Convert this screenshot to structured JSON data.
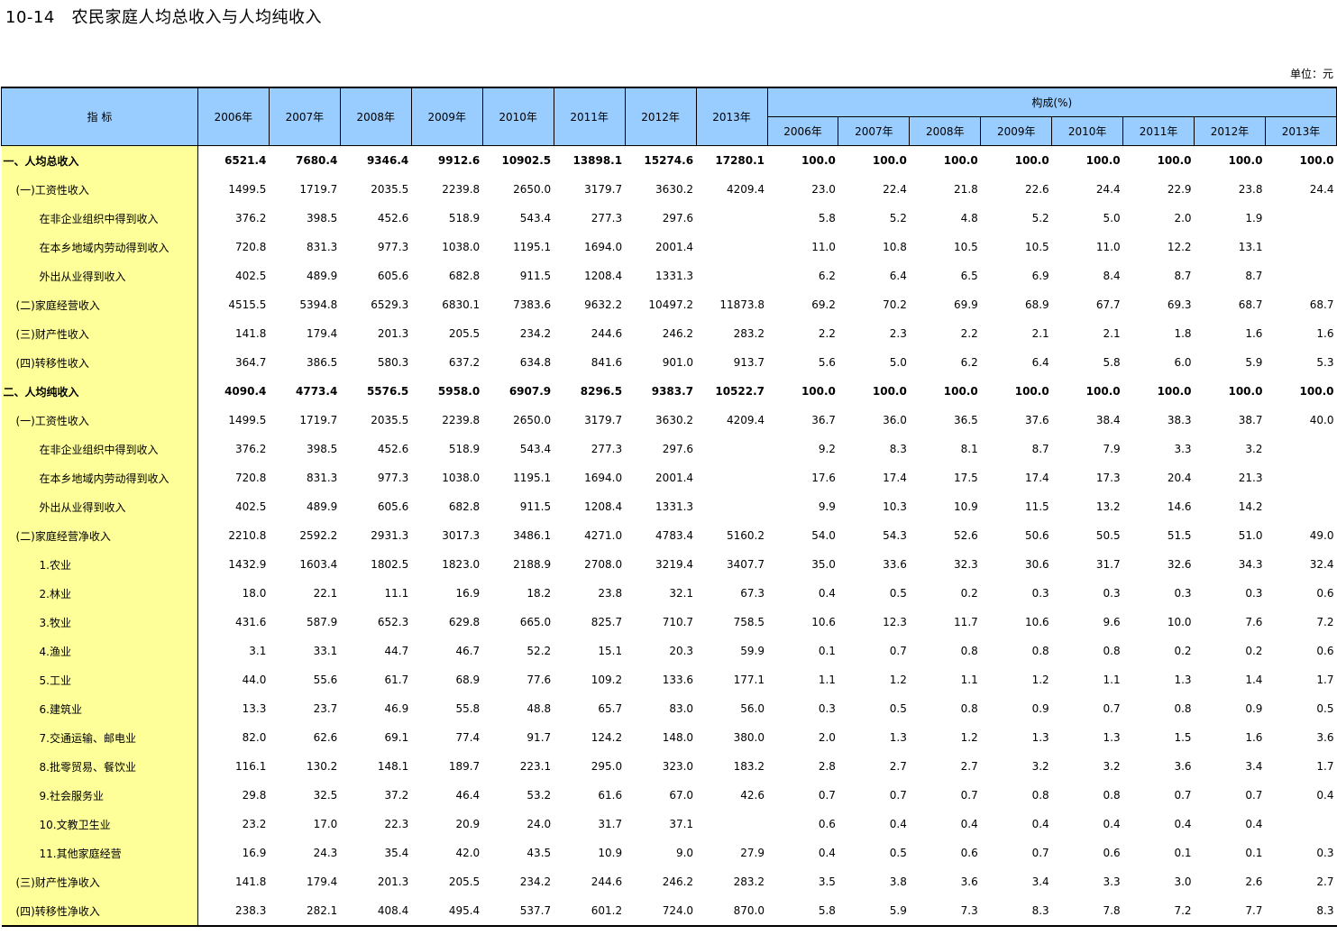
{
  "title": "10-14   农民家庭人均总收入与人均纯收入",
  "unit": "单位：元",
  "header": {
    "indicator": "指  标",
    "years": [
      "2006年",
      "2007年",
      "2008年",
      "2009年",
      "2010年",
      "2011年",
      "2012年",
      "2013年"
    ],
    "composition": "构成(%)",
    "comp_years": [
      "2006年",
      "2007年",
      "2008年",
      "2009年",
      "2010年",
      "2011年",
      "2012年",
      "2013年"
    ]
  },
  "rows": [
    {
      "label": "一、人均总收入",
      "level": 0,
      "bold": true,
      "v": [
        "6521.4",
        "7680.4",
        "9346.4",
        "9912.6",
        "10902.5",
        "13898.1",
        "15274.6",
        "17280.1"
      ],
      "c": [
        "100.0",
        "100.0",
        "100.0",
        "100.0",
        "100.0",
        "100.0",
        "100.0",
        "100.0"
      ]
    },
    {
      "label": "(一)工资性收入",
      "level": 1,
      "v": [
        "1499.5",
        "1719.7",
        "2035.5",
        "2239.8",
        "2650.0",
        "3179.7",
        "3630.2",
        "4209.4"
      ],
      "c": [
        "23.0",
        "22.4",
        "21.8",
        "22.6",
        "24.4",
        "22.9",
        "23.8",
        "24.4"
      ]
    },
    {
      "label": "在非企业组织中得到收入",
      "level": 2,
      "v": [
        "376.2",
        "398.5",
        "452.6",
        "518.9",
        "543.4",
        "277.3",
        "297.6",
        ""
      ],
      "c": [
        "5.8",
        "5.2",
        "4.8",
        "5.2",
        "5.0",
        "2.0",
        "1.9",
        ""
      ]
    },
    {
      "label": "在本乡地域内劳动得到收入",
      "level": 2,
      "v": [
        "720.8",
        "831.3",
        "977.3",
        "1038.0",
        "1195.1",
        "1694.0",
        "2001.4",
        ""
      ],
      "c": [
        "11.0",
        "10.8",
        "10.5",
        "10.5",
        "11.0",
        "12.2",
        "13.1",
        ""
      ]
    },
    {
      "label": "外出从业得到收入",
      "level": 2,
      "v": [
        "402.5",
        "489.9",
        "605.6",
        "682.8",
        "911.5",
        "1208.4",
        "1331.3",
        ""
      ],
      "c": [
        "6.2",
        "6.4",
        "6.5",
        "6.9",
        "8.4",
        "8.7",
        "8.7",
        ""
      ]
    },
    {
      "label": "(二)家庭经营收入",
      "level": 1,
      "v": [
        "4515.5",
        "5394.8",
        "6529.3",
        "6830.1",
        "7383.6",
        "9632.2",
        "10497.2",
        "11873.8"
      ],
      "c": [
        "69.2",
        "70.2",
        "69.9",
        "68.9",
        "67.7",
        "69.3",
        "68.7",
        "68.7"
      ]
    },
    {
      "label": "(三)财产性收入",
      "level": 1,
      "v": [
        "141.8",
        "179.4",
        "201.3",
        "205.5",
        "234.2",
        "244.6",
        "246.2",
        "283.2"
      ],
      "c": [
        "2.2",
        "2.3",
        "2.2",
        "2.1",
        "2.1",
        "1.8",
        "1.6",
        "1.6"
      ]
    },
    {
      "label": "(四)转移性收入",
      "level": 1,
      "v": [
        "364.7",
        "386.5",
        "580.3",
        "637.2",
        "634.8",
        "841.6",
        "901.0",
        "913.7"
      ],
      "c": [
        "5.6",
        "5.0",
        "6.2",
        "6.4",
        "5.8",
        "6.0",
        "5.9",
        "5.3"
      ]
    },
    {
      "label": "二、人均纯收入",
      "level": 0,
      "bold": true,
      "v": [
        "4090.4",
        "4773.4",
        "5576.5",
        "5958.0",
        "6907.9",
        "8296.5",
        "9383.7",
        "10522.7"
      ],
      "c": [
        "100.0",
        "100.0",
        "100.0",
        "100.0",
        "100.0",
        "100.0",
        "100.0",
        "100.0"
      ]
    },
    {
      "label": "(一)工资性收入",
      "level": 1,
      "v": [
        "1499.5",
        "1719.7",
        "2035.5",
        "2239.8",
        "2650.0",
        "3179.7",
        "3630.2",
        "4209.4"
      ],
      "c": [
        "36.7",
        "36.0",
        "36.5",
        "37.6",
        "38.4",
        "38.3",
        "38.7",
        "40.0"
      ]
    },
    {
      "label": "在非企业组织中得到收入",
      "level": 2,
      "v": [
        "376.2",
        "398.5",
        "452.6",
        "518.9",
        "543.4",
        "277.3",
        "297.6",
        ""
      ],
      "c": [
        "9.2",
        "8.3",
        "8.1",
        "8.7",
        "7.9",
        "3.3",
        "3.2",
        ""
      ]
    },
    {
      "label": "在本乡地域内劳动得到收入",
      "level": 2,
      "v": [
        "720.8",
        "831.3",
        "977.3",
        "1038.0",
        "1195.1",
        "1694.0",
        "2001.4",
        ""
      ],
      "c": [
        "17.6",
        "17.4",
        "17.5",
        "17.4",
        "17.3",
        "20.4",
        "21.3",
        ""
      ]
    },
    {
      "label": "外出从业得到收入",
      "level": 2,
      "v": [
        "402.5",
        "489.9",
        "605.6",
        "682.8",
        "911.5",
        "1208.4",
        "1331.3",
        ""
      ],
      "c": [
        "9.9",
        "10.3",
        "10.9",
        "11.5",
        "13.2",
        "14.6",
        "14.2",
        ""
      ]
    },
    {
      "label": "(二)家庭经营净收入",
      "level": 1,
      "v": [
        "2210.8",
        "2592.2",
        "2931.3",
        "3017.3",
        "3486.1",
        "4271.0",
        "4783.4",
        "5160.2"
      ],
      "c": [
        "54.0",
        "54.3",
        "52.6",
        "50.6",
        "50.5",
        "51.5",
        "51.0",
        "49.0"
      ]
    },
    {
      "label": "1.农业",
      "level": 3,
      "v": [
        "1432.9",
        "1603.4",
        "1802.5",
        "1823.0",
        "2188.9",
        "2708.0",
        "3219.4",
        "3407.7"
      ],
      "c": [
        "35.0",
        "33.6",
        "32.3",
        "30.6",
        "31.7",
        "32.6",
        "34.3",
        "32.4"
      ]
    },
    {
      "label": "2.林业",
      "level": 3,
      "v": [
        "18.0",
        "22.1",
        "11.1",
        "16.9",
        "18.2",
        "23.8",
        "32.1",
        "67.3"
      ],
      "c": [
        "0.4",
        "0.5",
        "0.2",
        "0.3",
        "0.3",
        "0.3",
        "0.3",
        "0.6"
      ]
    },
    {
      "label": "3.牧业",
      "level": 3,
      "v": [
        "431.6",
        "587.9",
        "652.3",
        "629.8",
        "665.0",
        "825.7",
        "710.7",
        "758.5"
      ],
      "c": [
        "10.6",
        "12.3",
        "11.7",
        "10.6",
        "9.6",
        "10.0",
        "7.6",
        "7.2"
      ]
    },
    {
      "label": "4.渔业",
      "level": 3,
      "v": [
        "3.1",
        "33.1",
        "44.7",
        "46.7",
        "52.2",
        "15.1",
        "20.3",
        "59.9"
      ],
      "c": [
        "0.1",
        "0.7",
        "0.8",
        "0.8",
        "0.8",
        "0.2",
        "0.2",
        "0.6"
      ]
    },
    {
      "label": "5.工业",
      "level": 3,
      "v": [
        "44.0",
        "55.6",
        "61.7",
        "68.9",
        "77.6",
        "109.2",
        "133.6",
        "177.1"
      ],
      "c": [
        "1.1",
        "1.2",
        "1.1",
        "1.2",
        "1.1",
        "1.3",
        "1.4",
        "1.7"
      ]
    },
    {
      "label": "6.建筑业",
      "level": 3,
      "v": [
        "13.3",
        "23.7",
        "46.9",
        "55.8",
        "48.8",
        "65.7",
        "83.0",
        "56.0"
      ],
      "c": [
        "0.3",
        "0.5",
        "0.8",
        "0.9",
        "0.7",
        "0.8",
        "0.9",
        "0.5"
      ]
    },
    {
      "label": "7.交通运输、邮电业",
      "level": 3,
      "v": [
        "82.0",
        "62.6",
        "69.1",
        "77.4",
        "91.7",
        "124.2",
        "148.0",
        "380.0"
      ],
      "c": [
        "2.0",
        "1.3",
        "1.2",
        "1.3",
        "1.3",
        "1.5",
        "1.6",
        "3.6"
      ]
    },
    {
      "label": "8.批零贸易、餐饮业",
      "level": 3,
      "v": [
        "116.1",
        "130.2",
        "148.1",
        "189.7",
        "223.1",
        "295.0",
        "323.0",
        "183.2"
      ],
      "c": [
        "2.8",
        "2.7",
        "2.7",
        "3.2",
        "3.2",
        "3.6",
        "3.4",
        "1.7"
      ]
    },
    {
      "label": "9.社会服务业",
      "level": 3,
      "v": [
        "29.8",
        "32.5",
        "37.2",
        "46.4",
        "53.2",
        "61.6",
        "67.0",
        "42.6"
      ],
      "c": [
        "0.7",
        "0.7",
        "0.7",
        "0.8",
        "0.8",
        "0.7",
        "0.7",
        "0.4"
      ]
    },
    {
      "label": "10.文教卫生业",
      "level": 3,
      "v": [
        "23.2",
        "17.0",
        "22.3",
        "20.9",
        "24.0",
        "31.7",
        "37.1",
        ""
      ],
      "c": [
        "0.6",
        "0.4",
        "0.4",
        "0.4",
        "0.4",
        "0.4",
        "0.4",
        ""
      ]
    },
    {
      "label": "11.其他家庭经营",
      "level": 3,
      "v": [
        "16.9",
        "24.3",
        "35.4",
        "42.0",
        "43.5",
        "10.9",
        "9.0",
        "27.9"
      ],
      "c": [
        "0.4",
        "0.5",
        "0.6",
        "0.7",
        "0.6",
        "0.1",
        "0.1",
        "0.3"
      ]
    },
    {
      "label": "(三)财产性净收入",
      "level": 1,
      "v": [
        "141.8",
        "179.4",
        "201.3",
        "205.5",
        "234.2",
        "244.6",
        "246.2",
        "283.2"
      ],
      "c": [
        "3.5",
        "3.8",
        "3.6",
        "3.4",
        "3.3",
        "3.0",
        "2.6",
        "2.7"
      ]
    },
    {
      "label": "(四)转移性净收入",
      "level": 1,
      "v": [
        "238.3",
        "282.1",
        "408.4",
        "495.4",
        "537.7",
        "601.2",
        "724.0",
        "870.0"
      ],
      "c": [
        "5.8",
        "5.9",
        "7.3",
        "8.3",
        "7.8",
        "7.2",
        "7.7",
        "8.3"
      ]
    }
  ]
}
